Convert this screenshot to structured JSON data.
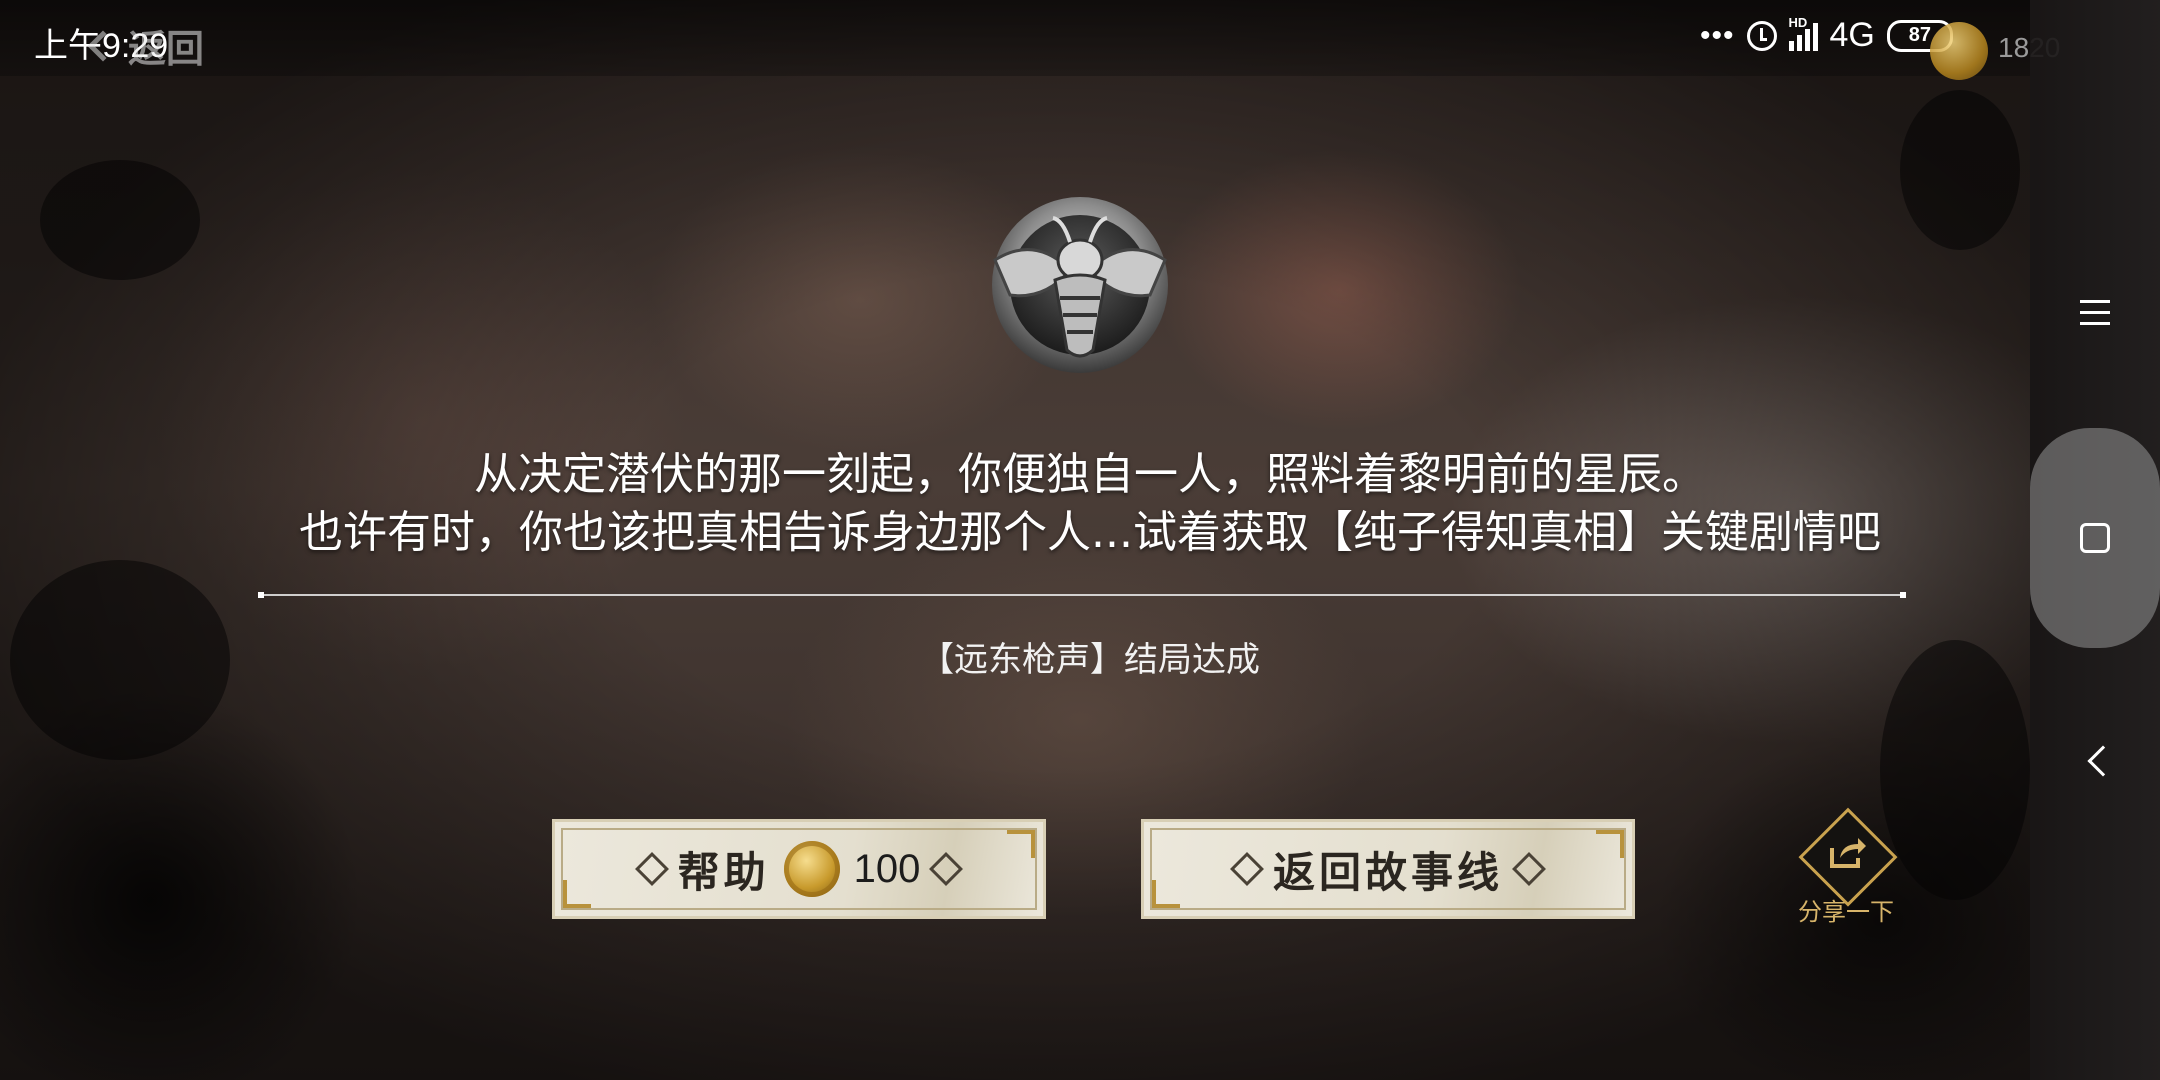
{
  "status_bar": {
    "time": "上午9:29",
    "back_label": "返回",
    "dots": "•••",
    "hd_badge": "HD",
    "network": "4G",
    "battery": "87",
    "coins": "1820"
  },
  "emblem": {
    "icon": "bee-crest-emblem-icon"
  },
  "message": {
    "line1": "从决定潜伏的那一刻起，你便独自一人，照料着黎明前的星辰。",
    "line2": "也许有时，你也该把真相告诉身边那个人...试着获取【纯子得知真相】关键剧情吧"
  },
  "ending_text": "【远东枪声】结局达成",
  "buttons": {
    "help_label": "帮助",
    "help_cost": "100",
    "return_label": "返回故事线"
  },
  "share": {
    "label": "分享一下",
    "icon": "share-icon"
  },
  "nav": {
    "menu": "menu-icon",
    "home": "home-icon",
    "back": "back-icon"
  },
  "colors": {
    "accent_gold": "#c9a24e",
    "button_bg": "#ece8dc",
    "text": "#ffffff"
  }
}
